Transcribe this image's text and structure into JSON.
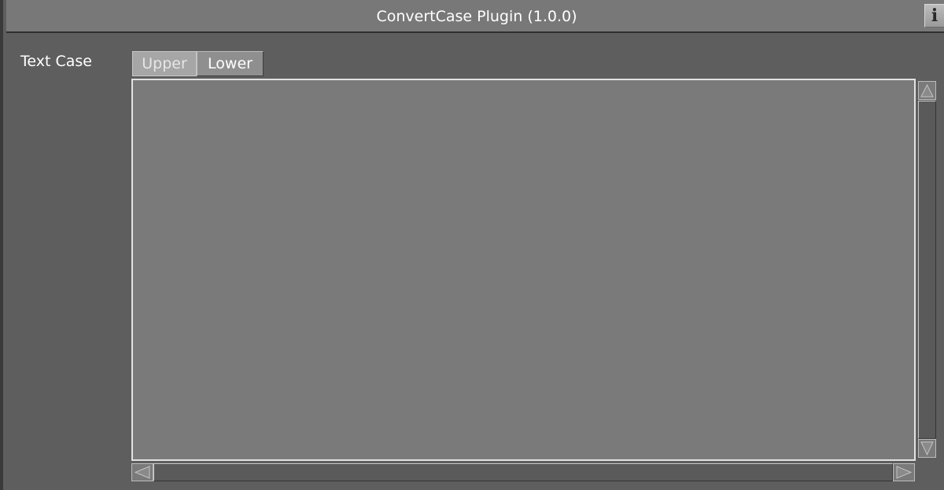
{
  "window": {
    "title": "ConvertCase Plugin (1.0.0)",
    "info_icon_glyph": "i",
    "info_icon": "info-icon"
  },
  "form": {
    "text_case_label": "Text Case",
    "case_options": [
      "Upper",
      "Lower"
    ],
    "selected_case": "Upper",
    "text_value": ""
  },
  "colors": {
    "background": "#5e5e5e",
    "titlebar": "#787878",
    "text_area": "#7a7a7a",
    "selected_button": "#a6a6a6",
    "button": "#8f8f8f"
  }
}
